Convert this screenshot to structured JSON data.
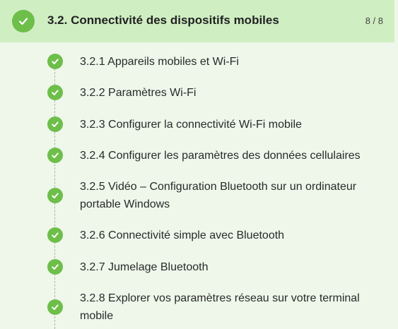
{
  "module": {
    "title": "3.2. Connectivité des dispositifs mobiles",
    "progress": "8 / 8",
    "completed": true,
    "accent_color": "#6ebe4a",
    "header_bg": "#cfeec2",
    "body_bg": "#eef7ea"
  },
  "items": [
    {
      "label": "3.2.1 Appareils mobiles et Wi-Fi",
      "completed": true
    },
    {
      "label": "3.2.2 Paramètres Wi-Fi",
      "completed": true
    },
    {
      "label": "3.2.3 Configurer la connectivité Wi-Fi mobile",
      "completed": true
    },
    {
      "label": "3.2.4 Configurer les paramètres des données cellulaires",
      "completed": true
    },
    {
      "label": "3.2.5 Vidéo – Configuration Bluetooth sur un ordinateur portable Windows",
      "completed": true
    },
    {
      "label": "3.2.6 Connectivité simple avec Bluetooth",
      "completed": true
    },
    {
      "label": "3.2.7 Jumelage Bluetooth",
      "completed": true
    },
    {
      "label": "3.2.8 Explorer vos paramètres réseau sur votre terminal mobile",
      "completed": true
    }
  ]
}
